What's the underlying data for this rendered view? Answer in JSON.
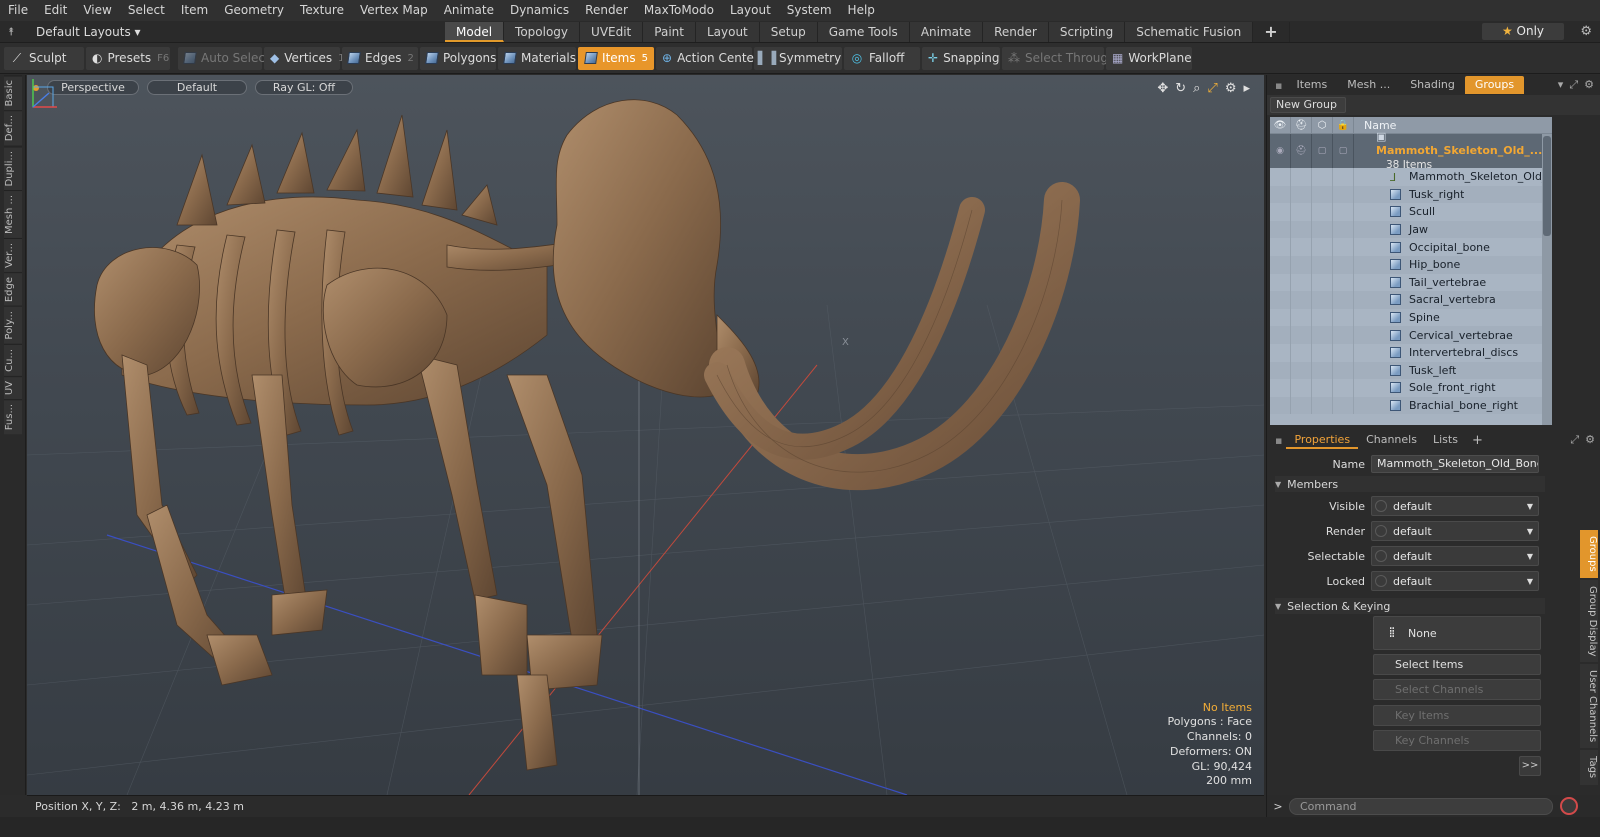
{
  "menu": [
    "File",
    "Edit",
    "View",
    "Select",
    "Item",
    "Geometry",
    "Texture",
    "Vertex Map",
    "Animate",
    "Dynamics",
    "Render",
    "MaxToModo",
    "Layout",
    "System",
    "Help"
  ],
  "layout_selector": "Default Layouts",
  "tabs": [
    {
      "label": "Model",
      "active": true
    },
    {
      "label": "Topology",
      "active": false
    },
    {
      "label": "UVEdit",
      "active": false
    },
    {
      "label": "Paint",
      "active": false
    },
    {
      "label": "Layout",
      "active": false
    },
    {
      "label": "Setup",
      "active": false
    },
    {
      "label": "Game Tools",
      "active": false
    },
    {
      "label": "Animate",
      "active": false
    },
    {
      "label": "Render",
      "active": false
    },
    {
      "label": "Scripting",
      "active": false
    },
    {
      "label": "Schematic Fusion",
      "active": false
    }
  ],
  "only_button": "Only",
  "toolbar": {
    "sculpt": "Sculpt",
    "presets": "Presets",
    "presets_key": "F6",
    "auto_select": "Auto Select",
    "vertices": "Vertices",
    "vertices_key": "1",
    "edges": "Edges",
    "edges_key": "2",
    "polygons": "Polygons",
    "materials": "Materials",
    "items": "Items",
    "items_key": "5",
    "action_center": "Action Center",
    "symmetry": "Symmetry",
    "falloff": "Falloff",
    "snapping": "Snapping",
    "select_through": "Select Through",
    "workplane": "WorkPlane"
  },
  "left_tabs": [
    "Basic",
    "Def...",
    "Dupli...",
    "Mesh ...",
    "Ver...",
    "Edge",
    "Poly...",
    "Cu...",
    "UV",
    "Fus..."
  ],
  "viewport": {
    "view": "Perspective",
    "shading": "Default",
    "raygl": "Ray GL: Off",
    "stats": {
      "selection": "No Items",
      "polygons": "Polygons : Face",
      "channels": "Channels: 0",
      "deformers": "Deformers: ON",
      "gl": "GL: 90,424",
      "units": "200 mm"
    },
    "center_label": "X"
  },
  "status": {
    "position_label": "Position X, Y, Z:",
    "position_value": "2 m, 4.36 m, 4.23 m"
  },
  "right_tabs": [
    {
      "label": "Items",
      "active": false
    },
    {
      "label": "Mesh ...",
      "active": false
    },
    {
      "label": "Shading",
      "active": false
    },
    {
      "label": "Groups",
      "active": true
    }
  ],
  "new_group": "New Group",
  "group_list": {
    "name_header": "Name",
    "parent": {
      "name": "Mammoth_Skeleton_Old_...",
      "count": "38 Items"
    },
    "items": [
      "Mammoth_Skeleton_Old_Bo ...",
      "Tusk_right",
      "Scull",
      "Jaw",
      "Occipital_bone",
      "Hip_bone",
      "Tail_vertebrae",
      "Sacral_vertebra",
      "Spine",
      "Cervical_vertebrae",
      "Intervertebral_discs",
      "Tusk_left",
      "Sole_front_right",
      "Brachial_bone_right"
    ]
  },
  "props_tabs": [
    {
      "label": "Properties",
      "active": true
    },
    {
      "label": "Channels",
      "active": false
    },
    {
      "label": "Lists",
      "active": false
    }
  ],
  "props": {
    "name_label": "Name",
    "name_value": "Mammoth_Skeleton_Old_Bones_\\",
    "members_header": "Members",
    "visible_label": "Visible",
    "visible_value": "default",
    "render_label": "Render",
    "render_value": "default",
    "selectable_label": "Selectable",
    "selectable_value": "default",
    "locked_label": "Locked",
    "locked_value": "default",
    "selkey_header": "Selection & Keying",
    "none_label": "None",
    "select_items": "Select Items",
    "select_channels": "Select Channels",
    "key_items": "Key Items",
    "key_channels": "Key Channels",
    "more": ">>"
  },
  "side_tabs": [
    "Groups",
    "Group Display",
    "User Channels",
    "Tags"
  ],
  "command_placeholder": "Command",
  "colors": {
    "accent": "#e2962c",
    "bone": "#8a6a4a",
    "viewport_top": "#4d545c",
    "grouplist": "#a7b3c1"
  }
}
